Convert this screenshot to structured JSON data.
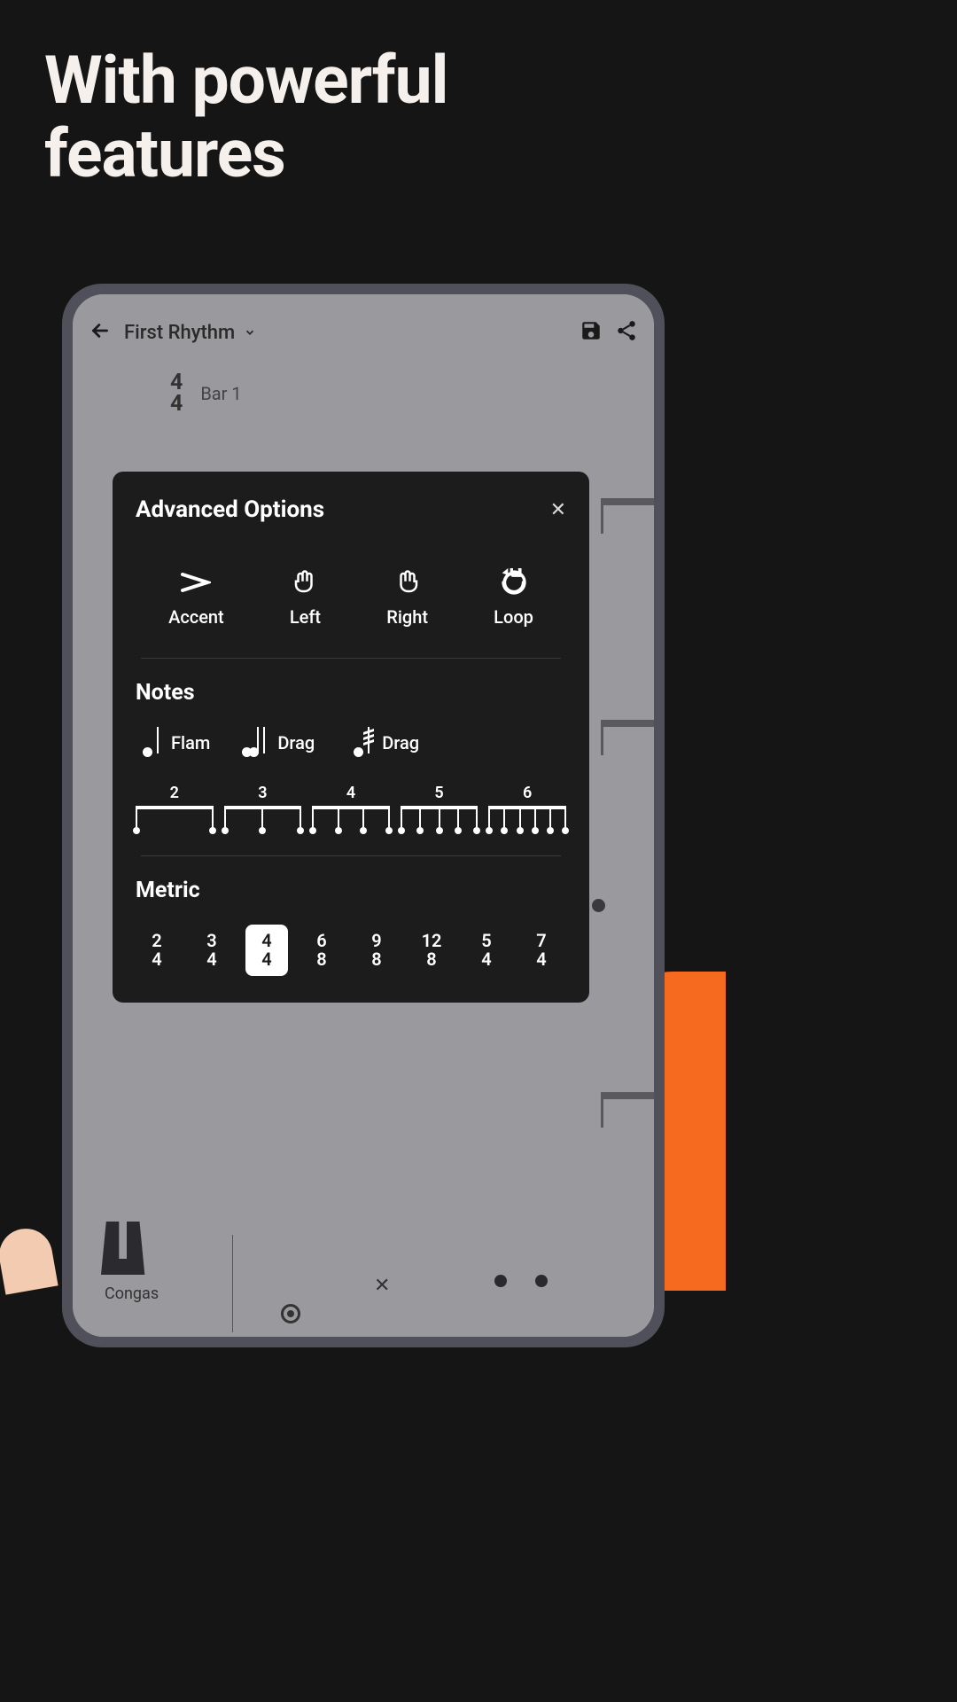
{
  "headline": "With powerful features",
  "app": {
    "title": "First Rhythm",
    "time_sig_top": "4",
    "time_sig_bottom": "4",
    "bar_label": "Bar 1",
    "instrument": "Congas"
  },
  "modal": {
    "title": "Advanced Options",
    "actions": [
      {
        "label": "Accent",
        "icon": "accent"
      },
      {
        "label": "Left",
        "icon": "hand-left"
      },
      {
        "label": "Right",
        "icon": "hand-right"
      },
      {
        "label": "Loop",
        "icon": "loop"
      }
    ],
    "notes_section": "Notes",
    "note_types": [
      {
        "label": "Flam",
        "kind": "flam"
      },
      {
        "label": "Drag",
        "kind": "drag"
      },
      {
        "label": "Drag",
        "kind": "roll"
      }
    ],
    "tuplets": [
      2,
      3,
      4,
      5,
      6
    ],
    "metric_section": "Metric",
    "metrics": [
      {
        "top": "2",
        "bottom": "4",
        "selected": false
      },
      {
        "top": "3",
        "bottom": "4",
        "selected": false
      },
      {
        "top": "4",
        "bottom": "4",
        "selected": true
      },
      {
        "top": "6",
        "bottom": "8",
        "selected": false
      },
      {
        "top": "9",
        "bottom": "8",
        "selected": false
      },
      {
        "top": "12",
        "bottom": "8",
        "selected": false
      },
      {
        "top": "5",
        "bottom": "4",
        "selected": false
      },
      {
        "top": "7",
        "bottom": "4",
        "selected": false
      }
    ]
  }
}
